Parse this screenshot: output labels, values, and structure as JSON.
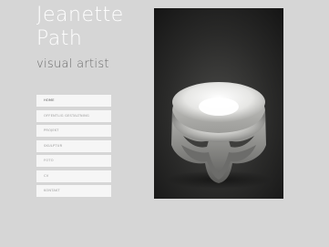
{
  "header": {
    "name_line1": "Jeanette",
    "name_line2": "Path",
    "tagline": "visual artist"
  },
  "nav": {
    "items": [
      {
        "label": "home",
        "active": true
      },
      {
        "label": "offentlig gestaltning",
        "active": false
      },
      {
        "label": "projekt",
        "active": false
      },
      {
        "label": "skulptur",
        "active": false
      },
      {
        "label": "foto",
        "active": false
      },
      {
        "label": "cv",
        "active": false
      },
      {
        "label": "kontakt",
        "active": false
      }
    ]
  },
  "artwork": {
    "alt": ""
  }
}
